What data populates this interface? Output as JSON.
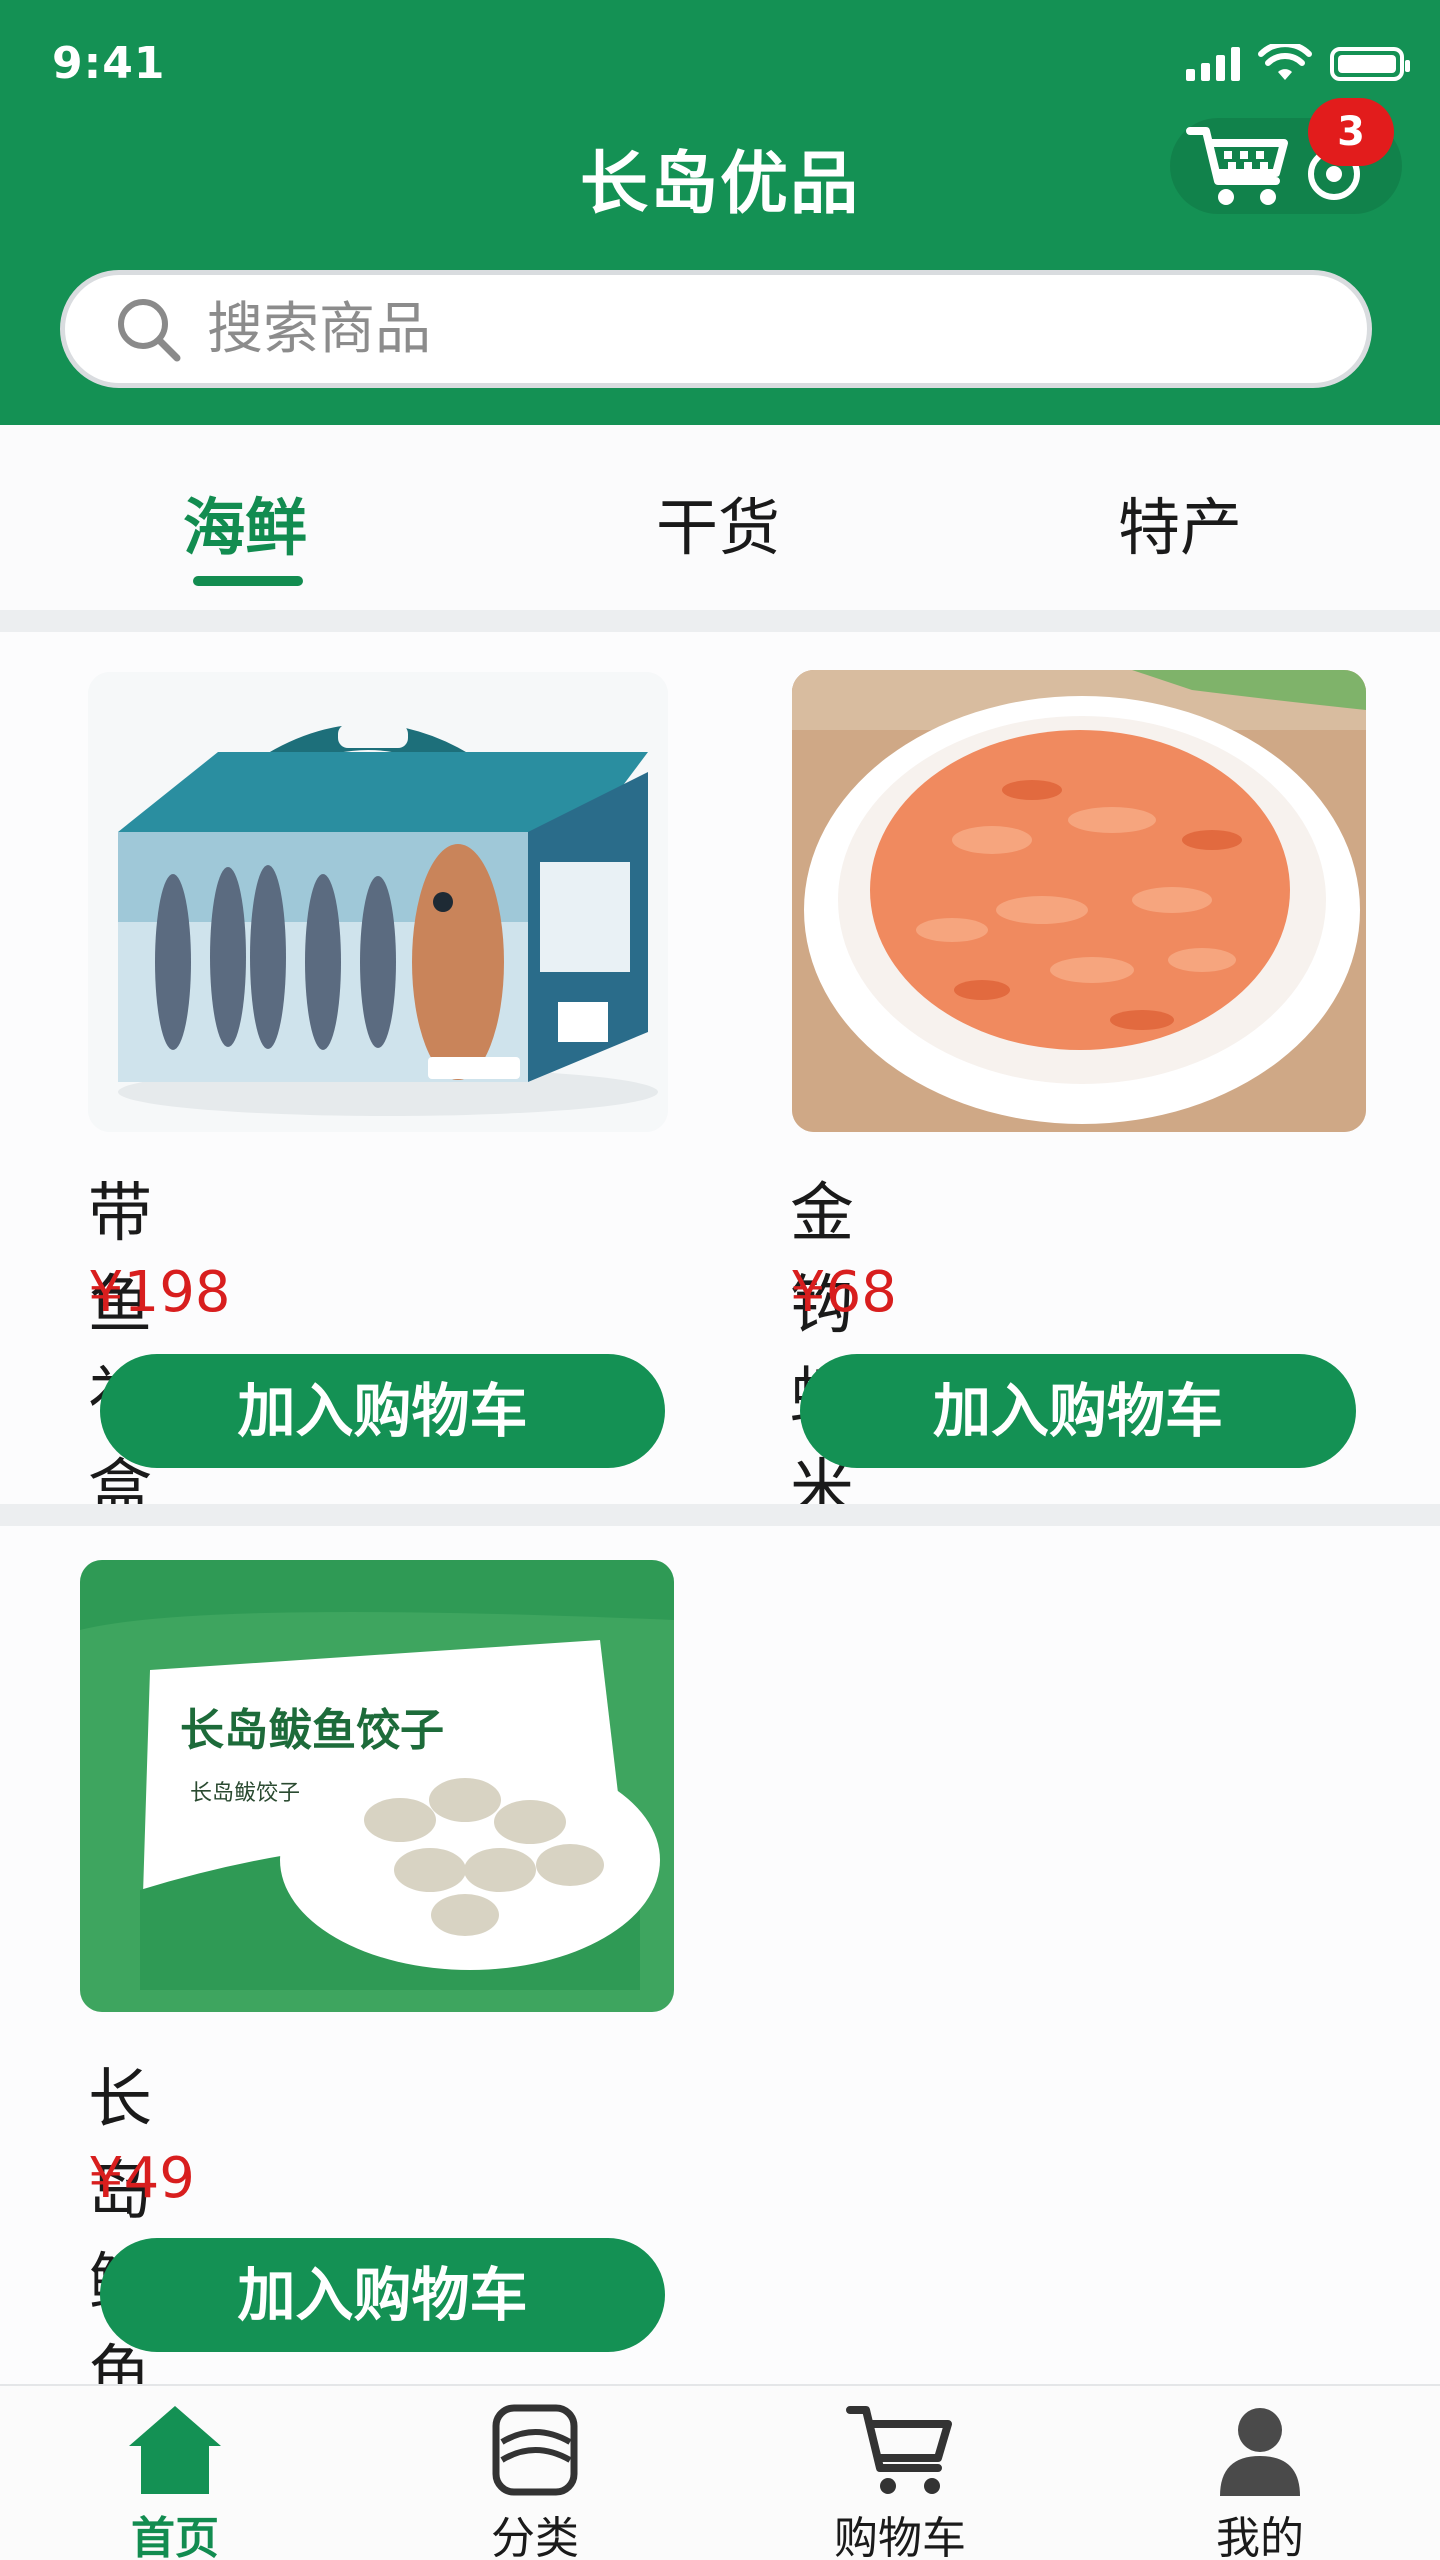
{
  "status": {
    "time": "9:41"
  },
  "header": {
    "title": "长岛优品",
    "cart_count": "3"
  },
  "search": {
    "placeholder": "搜索商品"
  },
  "tabs": [
    {
      "label": "海鲜",
      "active": true
    },
    {
      "label": "干货",
      "active": false
    },
    {
      "label": "特产",
      "active": false
    }
  ],
  "products": [
    {
      "name": "带鱼礼盒",
      "price": "¥198",
      "button": "加入购物车",
      "image": "fish-gift-box"
    },
    {
      "name": "金钩虾米",
      "price": "¥68",
      "button": "加入购物车",
      "image": "dried-shrimp-bowl"
    },
    {
      "name": "长岛鲅鱼饺子",
      "price": "¥49",
      "button": "加入购物车",
      "image": "dumpling-package",
      "package_text": "长岛鲅鱼饺子",
      "package_subtext": "长岛鲅饺子"
    }
  ],
  "nav": [
    {
      "label": "首页",
      "icon": "home-icon",
      "active": true
    },
    {
      "label": "分类",
      "icon": "category-icon",
      "active": false
    },
    {
      "label": "购物车",
      "icon": "cart-icon",
      "active": false
    },
    {
      "label": "我的",
      "icon": "profile-icon",
      "active": false
    }
  ],
  "colors": {
    "brand_green": "#149154",
    "price_red": "#d81e1e",
    "badge_red": "#e21c1c"
  }
}
